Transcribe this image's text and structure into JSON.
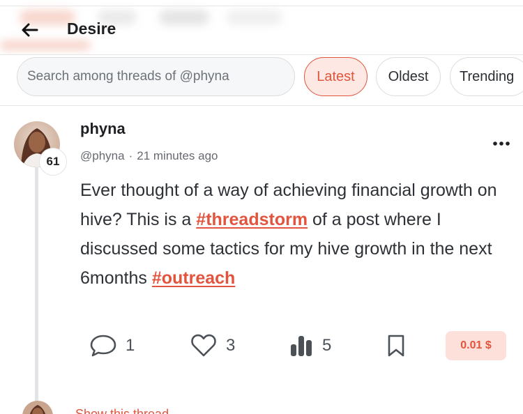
{
  "header": {
    "title": "Desire",
    "back_icon": "arrow-left-icon"
  },
  "filters": {
    "search_placeholder": "Search among threads of @phyna",
    "sort_options": [
      "Latest",
      "Oldest",
      "Trending"
    ],
    "selected": "Latest"
  },
  "post": {
    "author": {
      "name": "phyna",
      "handle": "@phyna",
      "reputation": "61",
      "avatar_icon": "user-avatar"
    },
    "time_ago": "21 minutes ago",
    "separator": "·",
    "body": {
      "part1": "Ever thought of a way of achieving financial growth on hive? This is a ",
      "tag1": "#threadstorm",
      "part2": " of a post where I discussed some tactics for my hive growth in the next 6months ",
      "tag2": "#outreach"
    },
    "stats": {
      "replies": "1",
      "likes": "3",
      "views": "5",
      "payout": "0.01 $"
    }
  },
  "next": {
    "show_thread_label": "Show this thread"
  },
  "colors": {
    "accent": "#e2543d",
    "accent_bg": "#fde8e3",
    "payout_bg": "#fde0d9"
  }
}
